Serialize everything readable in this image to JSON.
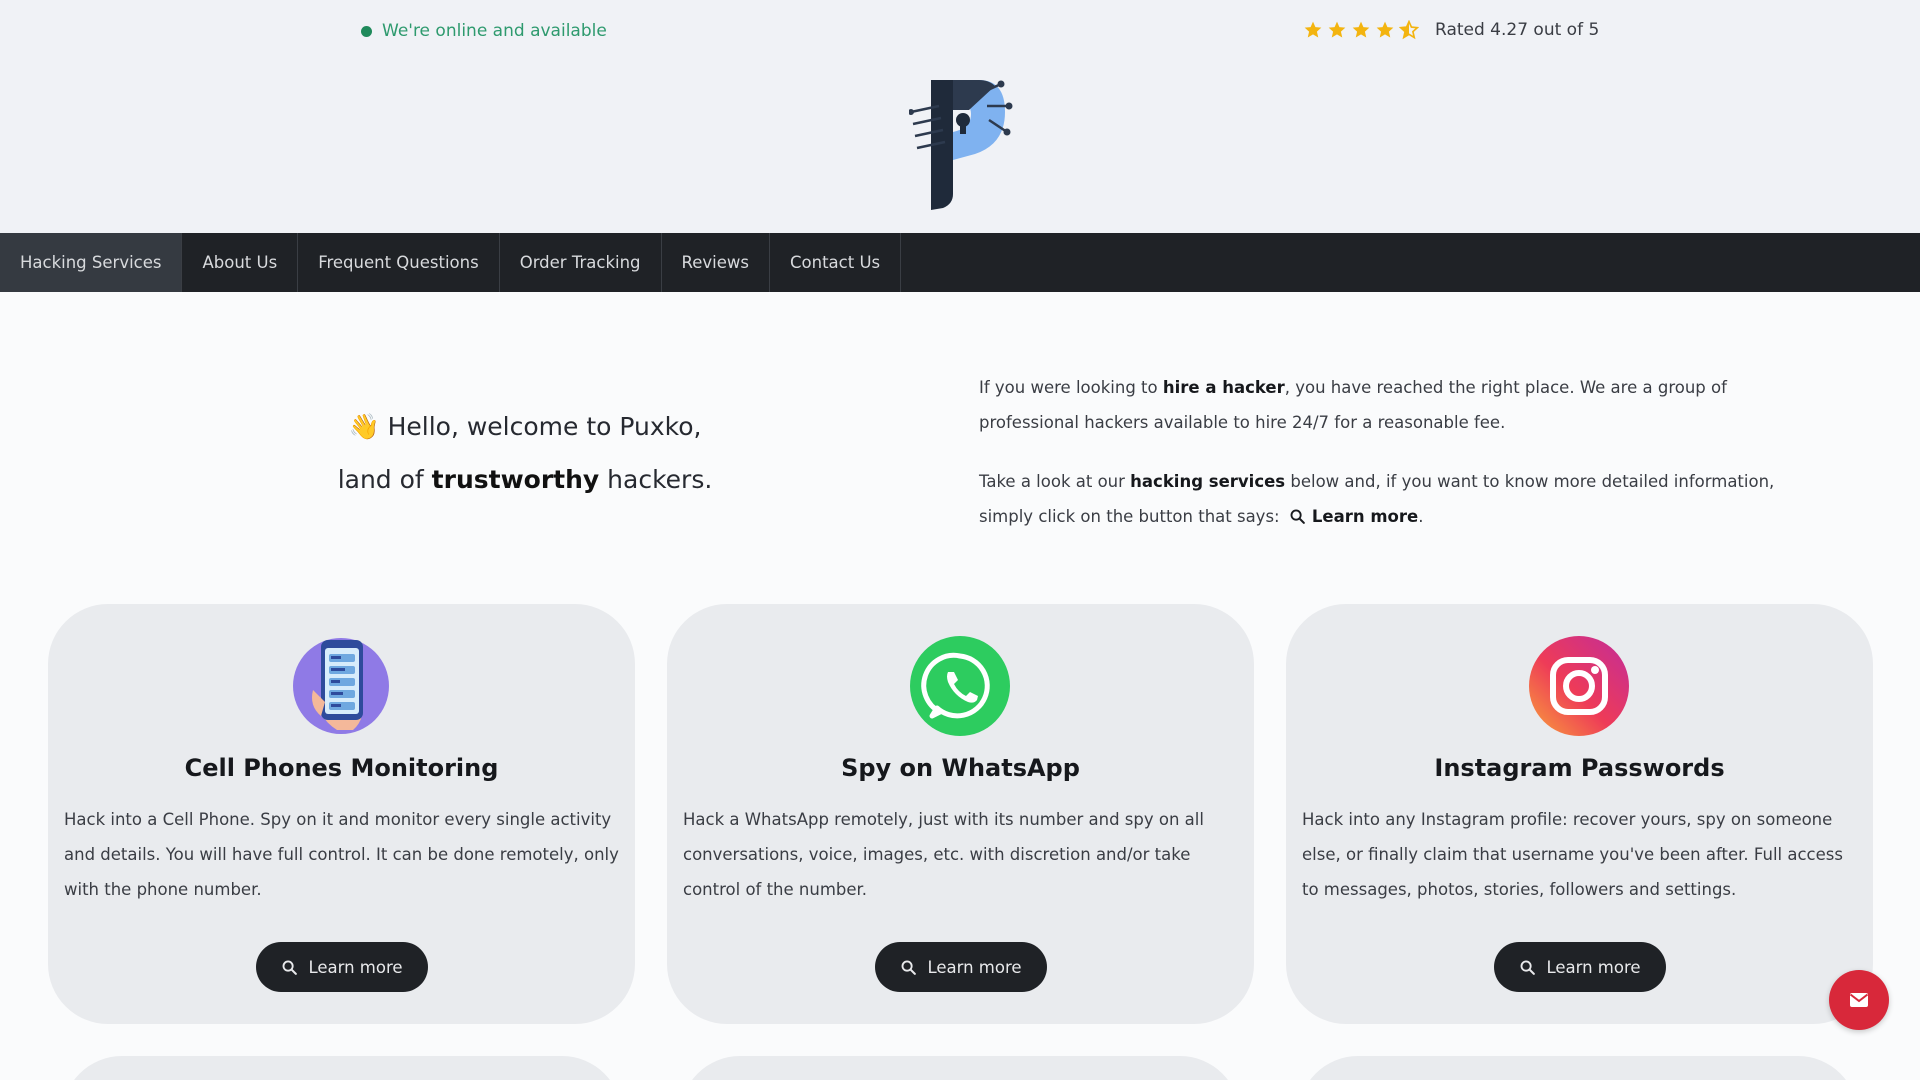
{
  "header": {
    "online_text": "We're online and available",
    "rating_text": "Rated 4.27 out of 5",
    "rating_value": 4.27,
    "rating_max": 5,
    "logo_icon": "puxko-logo-icon"
  },
  "nav": {
    "items": [
      {
        "label": "Hacking Services"
      },
      {
        "label": "About Us"
      },
      {
        "label": "Frequent Questions"
      },
      {
        "label": "Order Tracking"
      },
      {
        "label": "Reviews"
      },
      {
        "label": "Contact Us"
      }
    ]
  },
  "hero": {
    "emoji": "👋",
    "line1": "Hello, welcome to Puxko,",
    "line2_pre": "land of ",
    "line2_bold": "trustworthy",
    "line2_post": " hackers."
  },
  "intro": {
    "p1_pre": "If you were looking to ",
    "p1_bold": "hire a hacker",
    "p1_post": ", you have reached the right place. We are a group of professional hackers available to hire 24/7 for a reasonable fee.",
    "p2_pre": "Take a look at our ",
    "p2_bold": "hacking services",
    "p2_mid": " below and, if you want to know more detailed information, simply click on the button that says:",
    "p2_btn": "Learn more",
    "p2_end": "."
  },
  "cards": [
    {
      "icon": "phone-monitoring-icon",
      "title": "Cell Phones Monitoring",
      "text": "Hack into a Cell Phone. Spy on it and monitor every single activity and details. You will have full control. It can be done remotely, only with the phone number.",
      "button": "Learn more"
    },
    {
      "icon": "whatsapp-icon",
      "title": "Spy on WhatsApp",
      "text": "Hack a WhatsApp remotely, just with its number and spy on all conversations, voice, images, etc. with discretion and/or take control of the number.",
      "button": "Learn more"
    },
    {
      "icon": "instagram-icon",
      "title": "Instagram Passwords",
      "text": "Hack into any Instagram profile: recover yours, spy on someone else, or finally claim that username you've been after. Full access to messages, photos, stories, followers and settings.",
      "button": "Learn more"
    }
  ],
  "colors": {
    "nav_bg": "#1f2226",
    "card_bg": "#e9ebee",
    "online_green": "#2e9a6e",
    "star_gold": "#f3b40f",
    "fab_red": "#d8283a"
  },
  "fab": {
    "icon": "mail-icon"
  }
}
